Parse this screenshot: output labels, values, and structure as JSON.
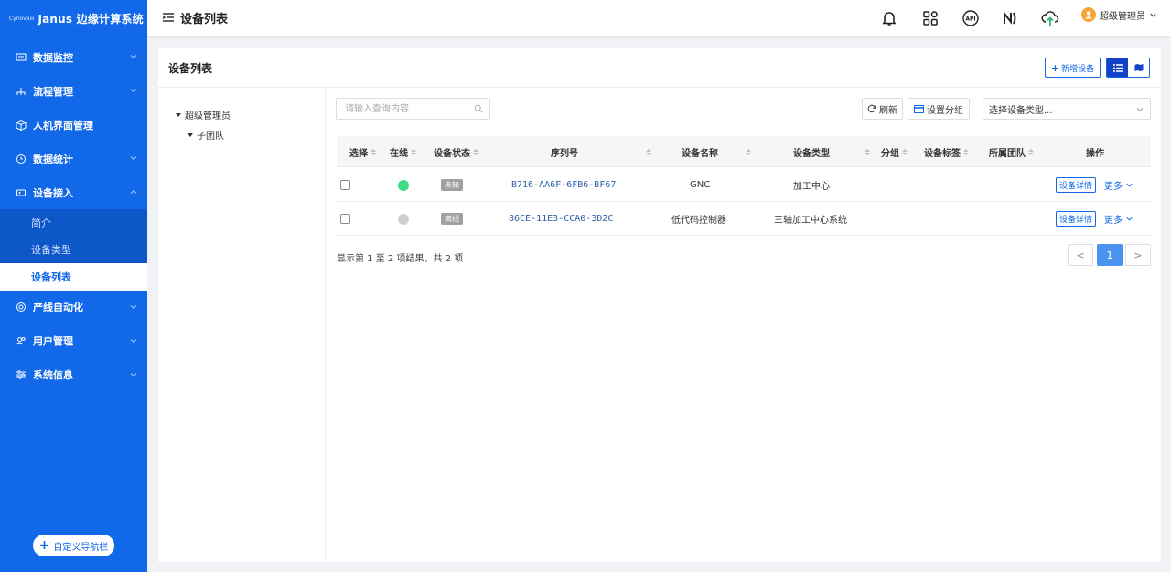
{
  "brand": {
    "small": "Cynovaiii",
    "title": "Janus 边缘计算系统"
  },
  "sidebar": {
    "items": [
      {
        "label": "数据监控",
        "icon": "monitor-icon"
      },
      {
        "label": "流程管理",
        "icon": "flow-icon"
      },
      {
        "label": "人机界面管理",
        "icon": "cube-icon"
      },
      {
        "label": "数据统计",
        "icon": "clock-icon"
      },
      {
        "label": "设备接入",
        "icon": "device-icon",
        "expanded": true,
        "children": [
          {
            "label": "简介"
          },
          {
            "label": "设备类型"
          },
          {
            "label": "设备列表",
            "active": true
          }
        ]
      },
      {
        "label": "产线自动化",
        "icon": "target-icon"
      },
      {
        "label": "用户管理",
        "icon": "users-icon"
      },
      {
        "label": "系统信息",
        "icon": "sliders-icon"
      }
    ],
    "custom_nav": "自定义导航栏"
  },
  "topbar": {
    "title": "设备列表",
    "user": "超级管理员"
  },
  "panel": {
    "title": "设备列表",
    "add_button": "新增设备"
  },
  "tree": {
    "root": "超级管理员",
    "child": "子团队"
  },
  "toolbar": {
    "search_placeholder": "请输入查询内容",
    "refresh": "刷新",
    "group": "设置分组",
    "type_select": "选择设备类型..."
  },
  "table": {
    "headers": {
      "select": "选择",
      "online": "在线",
      "status": "设备状态",
      "serial": "序列号",
      "name": "设备名称",
      "type": "设备类型",
      "group": "分组",
      "tags": "设备标签",
      "team": "所属团队",
      "action": "操作"
    },
    "rows": [
      {
        "online_color": "#3ddc84",
        "status": "未知",
        "serial": "B716-AA6F-6FB6-BF67",
        "name": "GNC",
        "type": "加工中心",
        "detail": "设备详情",
        "more": "更多"
      },
      {
        "online_color": "#cfcfcf",
        "status": "离线",
        "serial": "86CE-11E3-CCA0-3D2C",
        "name": "低代码控制器",
        "type": "三轴加工中心系统",
        "detail": "设备详情",
        "more": "更多"
      }
    ]
  },
  "pagination": {
    "info": "显示第 1 至 2 项结果，共 2 项",
    "prev": "<",
    "page": "1",
    "next": ">"
  }
}
